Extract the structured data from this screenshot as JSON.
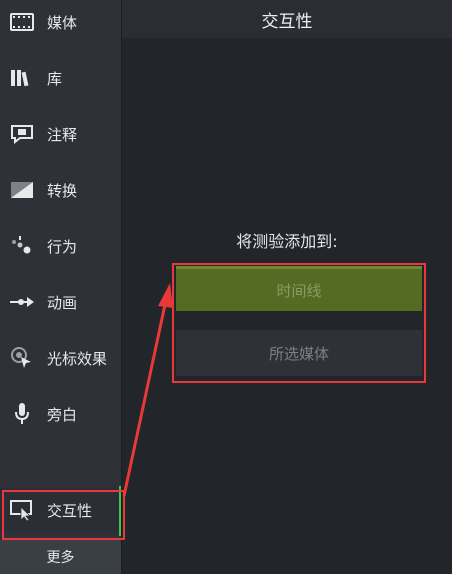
{
  "sidebar": {
    "items": [
      {
        "label": "媒体",
        "icon": "film-icon"
      },
      {
        "label": "库",
        "icon": "library-icon"
      },
      {
        "label": "注释",
        "icon": "annotation-icon"
      },
      {
        "label": "转换",
        "icon": "transition-icon"
      },
      {
        "label": "行为",
        "icon": "behavior-icon"
      },
      {
        "label": "动画",
        "icon": "animation-icon"
      },
      {
        "label": "光标效果",
        "icon": "cursor-effect-icon"
      },
      {
        "label": "旁白",
        "icon": "microphone-icon"
      }
    ],
    "active": {
      "label": "交互性",
      "icon": "interactivity-icon"
    },
    "more_label": "更多"
  },
  "panel": {
    "title": "交互性",
    "add_prompt": "将测验添加到:",
    "options": {
      "timeline": "时间线",
      "selected_media": "所选媒体"
    }
  },
  "colors": {
    "accent_green": "#556b24",
    "highlight_red": "#e8383a"
  }
}
